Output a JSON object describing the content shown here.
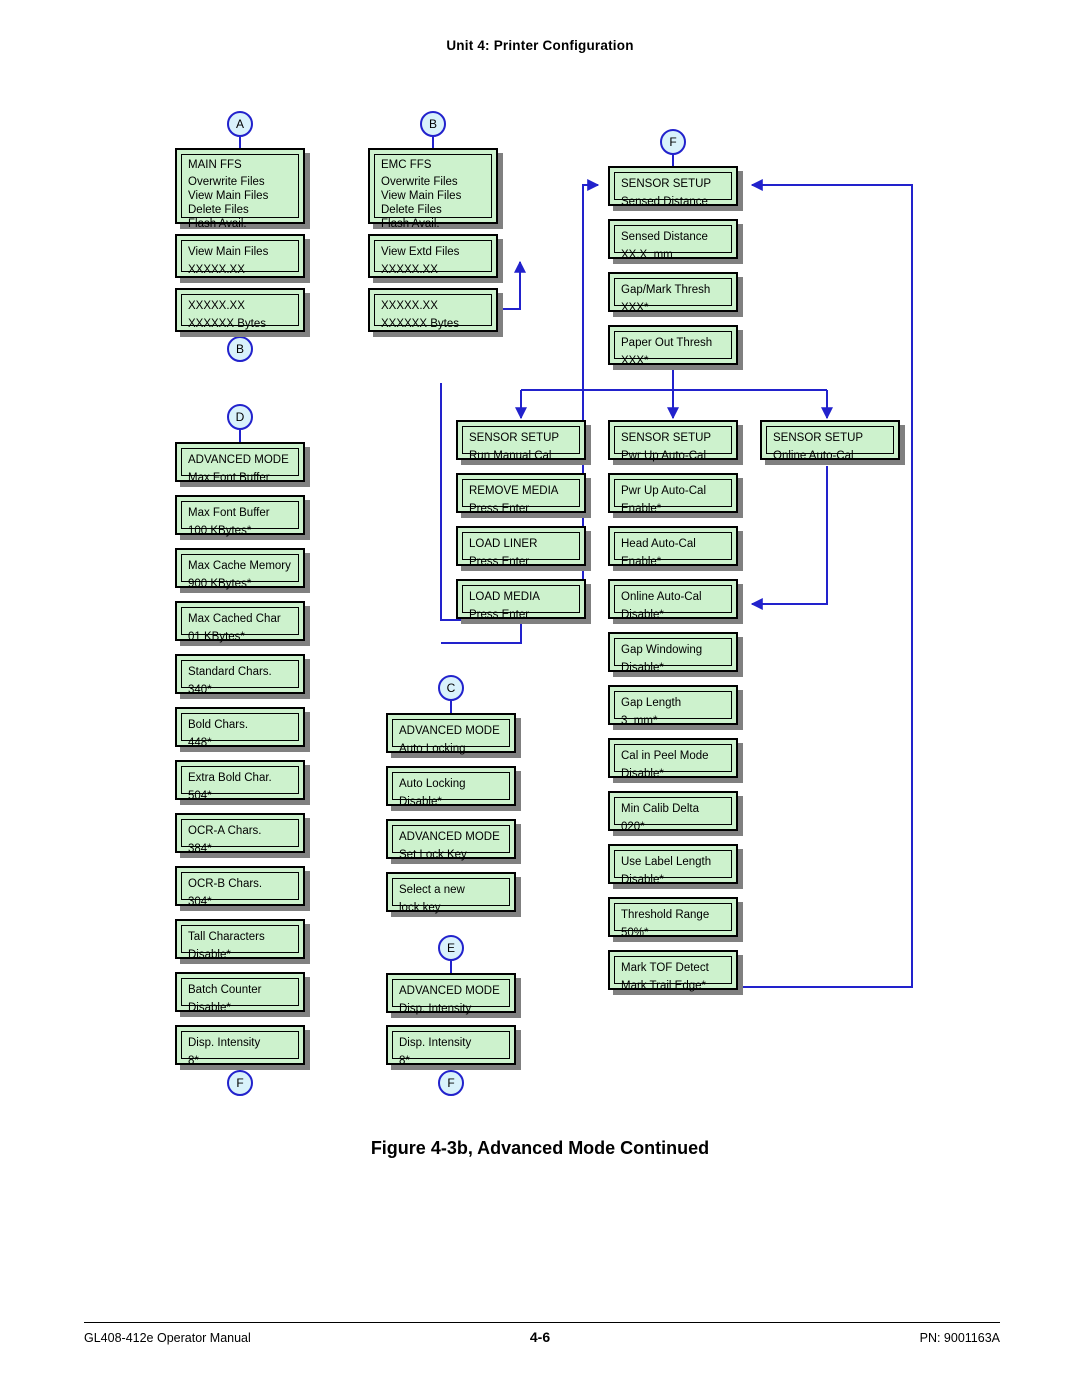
{
  "page": {
    "header": "Unit 4:  Printer Configuration",
    "figure_caption": "Figure 4-3b, Advanced Mode Continued",
    "footer_left": "GL408-412e Operator Manual",
    "footer_page": "4-6",
    "footer_right": "PN: 9001163A"
  },
  "colors": {
    "lcd_fill": "#cdf2cd",
    "lcd_border": "#000000",
    "lcd_shadow": "#808080",
    "wire": "#2222cc",
    "bubble_fill": "#d9f2fb",
    "bubble_border": "#2222cc"
  },
  "bubbles": [
    {
      "id": "bubble-a-top",
      "label": "A"
    },
    {
      "id": "bubble-b-top",
      "label": "B"
    },
    {
      "id": "bubble-f-top",
      "label": "F"
    },
    {
      "id": "bubble-b-bottom",
      "label": "B"
    },
    {
      "id": "bubble-d",
      "label": "D"
    },
    {
      "id": "bubble-c",
      "label": "C"
    },
    {
      "id": "bubble-e",
      "label": "E"
    },
    {
      "id": "bubble-f-left",
      "label": "F"
    },
    {
      "id": "bubble-f-mid",
      "label": "F"
    }
  ],
  "boxes": {
    "main_ffs": {
      "lines": [
        "MAIN FFS",
        "Overwrite Files",
        "View Main Files",
        "Delete Files",
        "Flash Avail."
      ]
    },
    "main_view_files": {
      "lines": [
        "View Main Files",
        "XXXXX.XX"
      ]
    },
    "main_file_bytes": {
      "lines": [
        "XXXXX.XX",
        "XXXXXX Bytes"
      ]
    },
    "emc_ffs": {
      "lines": [
        "EMC FFS",
        "Overwrite Files",
        "View Main Files",
        "Delete Files",
        "Flash Avail."
      ]
    },
    "emc_view_files": {
      "lines": [
        "View Extd Files",
        "XXXXX.XX"
      ]
    },
    "emc_file_bytes": {
      "lines": [
        "XXXXX.XX",
        "XXXXXX Bytes"
      ]
    },
    "adv_max_font_buffer": {
      "lines": [
        "ADVANCED MODE",
        "Max Font Buffer"
      ]
    },
    "max_font_buffer": {
      "lines": [
        "Max Font Buffer",
        "100 KBytes*"
      ]
    },
    "max_cache_memory": {
      "lines": [
        "Max Cache Memory",
        "900 KBytes*"
      ]
    },
    "max_cached_char": {
      "lines": [
        "Max Cached Char",
        "01 KBytes*"
      ]
    },
    "standard_chars": {
      "lines": [
        "Standard Chars.",
        "340*"
      ]
    },
    "bold_chars": {
      "lines": [
        "Bold Chars.",
        "448*"
      ]
    },
    "extra_bold_char": {
      "lines": [
        "Extra Bold Char.",
        "504*"
      ]
    },
    "ocr_a_chars": {
      "lines": [
        "OCR-A Chars.",
        "384*"
      ]
    },
    "ocr_b_chars": {
      "lines": [
        "OCR-B Chars.",
        "304*"
      ]
    },
    "tall_characters": {
      "lines": [
        "Tall Characters",
        "Disable*"
      ]
    },
    "batch_counter": {
      "lines": [
        "Batch Counter",
        "Disable*"
      ]
    },
    "disp_intensity_left": {
      "lines": [
        "Disp. Intensity",
        "8*"
      ]
    },
    "adv_auto_locking": {
      "lines": [
        "ADVANCED MODE",
        "Auto Locking"
      ]
    },
    "auto_locking": {
      "lines": [
        "Auto Locking",
        "Disable*"
      ]
    },
    "adv_set_lock_key": {
      "lines": [
        "ADVANCED MODE",
        "Set Lock Key"
      ]
    },
    "select_lock_key": {
      "lines": [
        "Select a new",
        "lock key"
      ]
    },
    "adv_disp_intensity": {
      "lines": [
        "ADVANCED MODE",
        "Disp. Intensity"
      ]
    },
    "disp_intensity_mid": {
      "lines": [
        "Disp. Intensity",
        "8*"
      ]
    },
    "sensor_sensed_distance": {
      "lines": [
        "SENSOR SETUP",
        "Sensed Distance"
      ]
    },
    "sensed_distance": {
      "lines": [
        "Sensed Distance",
        "XX.X  mm"
      ]
    },
    "gap_mark_thresh": {
      "lines": [
        "Gap/Mark Thresh",
        "XXX*"
      ]
    },
    "paper_out_thresh": {
      "lines": [
        "Paper Out Thresh",
        "XXX*"
      ]
    },
    "sensor_run_manual_cal": {
      "lines": [
        "SENSOR SETUP",
        "Run Manual Cal"
      ]
    },
    "remove_media": {
      "lines": [
        "REMOVE MEDIA",
        "Press Enter"
      ]
    },
    "load_liner": {
      "lines": [
        "LOAD LINER",
        "Press Enter"
      ]
    },
    "load_media": {
      "lines": [
        "LOAD MEDIA",
        "Press Enter"
      ]
    },
    "sensor_pwr_up_auto_cal": {
      "lines": [
        "SENSOR SETUP",
        "Pwr Up Auto-Cal"
      ]
    },
    "pwr_up_auto_cal": {
      "lines": [
        "Pwr Up Auto-Cal",
        "Enable*"
      ]
    },
    "head_auto_cal": {
      "lines": [
        "Head Auto-Cal",
        "Enable*"
      ]
    },
    "online_auto_cal": {
      "lines": [
        "Online Auto-Cal",
        "Disable*"
      ]
    },
    "gap_windowing": {
      "lines": [
        "Gap Windowing",
        "Disable*"
      ]
    },
    "gap_length": {
      "lines": [
        "Gap Length",
        "3  mm*"
      ]
    },
    "cal_in_peel_mode": {
      "lines": [
        "Cal in Peel Mode",
        "Disable*"
      ]
    },
    "min_calib_delta": {
      "lines": [
        "Min Calib Delta",
        "020*"
      ]
    },
    "use_label_length": {
      "lines": [
        "Use Label Length",
        "Disable*"
      ]
    },
    "threshold_range": {
      "lines": [
        "Threshold Range",
        "50%*"
      ]
    },
    "mark_tof_detect": {
      "lines": [
        "Mark TOF Detect",
        "Mark Trail Edge*"
      ]
    },
    "sensor_online_auto_cal": {
      "lines": [
        "SENSOR SETUP",
        "Online Auto-Cal"
      ]
    }
  }
}
